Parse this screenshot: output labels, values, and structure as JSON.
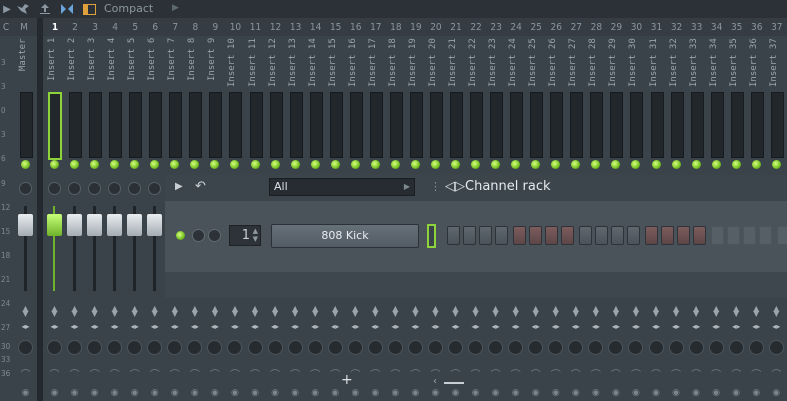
{
  "toolbar": {
    "label": "Compact",
    "icons": [
      "arrow-right-icon",
      "bird-icon",
      "person-upload-icon",
      "bowtie-icon",
      "window-icon",
      "chevron-right-icon"
    ]
  },
  "header": {
    "cells": [
      "C",
      "M",
      "1",
      "2",
      "3",
      "4",
      "5",
      "6",
      "7",
      "8",
      "9",
      "10",
      "11",
      "12",
      "13",
      "14",
      "15",
      "16",
      "17",
      "18",
      "19",
      "20",
      "21",
      "22",
      "23",
      "24",
      "25",
      "26",
      "27",
      "28",
      "29",
      "30",
      "31",
      "32",
      "33",
      "34",
      "35",
      "36",
      "37"
    ],
    "active_index": 2
  },
  "db_scale": [
    "3",
    "3",
    "0",
    "3",
    "6",
    "9",
    "12",
    "15",
    "18",
    "21",
    "24",
    "27",
    "30",
    "33",
    "36"
  ],
  "strips": [
    {
      "name": "Master"
    },
    {
      "name": "Insert 1"
    },
    {
      "name": "Insert 2"
    },
    {
      "name": "Insert 3"
    },
    {
      "name": "Insert 4"
    },
    {
      "name": "Insert 5"
    },
    {
      "name": "Insert 6"
    },
    {
      "name": "Insert 7"
    },
    {
      "name": "Insert 8"
    },
    {
      "name": "Insert 9"
    },
    {
      "name": "Insert 10"
    },
    {
      "name": "Insert 11"
    },
    {
      "name": "Insert 12"
    },
    {
      "name": "Insert 13"
    },
    {
      "name": "Insert 14"
    },
    {
      "name": "Insert 15"
    },
    {
      "name": "Insert 16"
    },
    {
      "name": "Insert 17"
    },
    {
      "name": "Insert 18"
    },
    {
      "name": "Insert 19"
    },
    {
      "name": "Insert 20"
    },
    {
      "name": "Insert 21"
    },
    {
      "name": "Insert 22"
    },
    {
      "name": "Insert 23"
    },
    {
      "name": "Insert 24"
    },
    {
      "name": "Insert 25"
    },
    {
      "name": "Insert 26"
    },
    {
      "name": "Insert 27"
    },
    {
      "name": "Insert 28"
    },
    {
      "name": "Insert 29"
    },
    {
      "name": "Insert 30"
    },
    {
      "name": "Insert 31"
    },
    {
      "name": "Insert 32"
    },
    {
      "name": "Insert 33"
    },
    {
      "name": "Insert 34"
    },
    {
      "name": "Insert 35"
    },
    {
      "name": "Insert 36"
    },
    {
      "name": "Insert 37"
    }
  ],
  "selected_strip": 1,
  "channel_rack": {
    "filter": "All",
    "title": "Channel rack",
    "channel": {
      "name": "808 Kick",
      "number": "1",
      "steps": [
        "gray",
        "gray",
        "gray",
        "gray",
        "red",
        "red",
        "red",
        "red",
        "gray",
        "gray",
        "gray",
        "gray",
        "red",
        "red",
        "red",
        "red",
        "dim",
        "dim",
        "dim",
        "dim",
        "dim",
        "dim"
      ]
    },
    "add_label": "+",
    "scroll_label": "‹"
  },
  "colors": {
    "background": "#3b434a",
    "accent_green": "#8fd33a",
    "step_red": "#7d5c5d"
  }
}
